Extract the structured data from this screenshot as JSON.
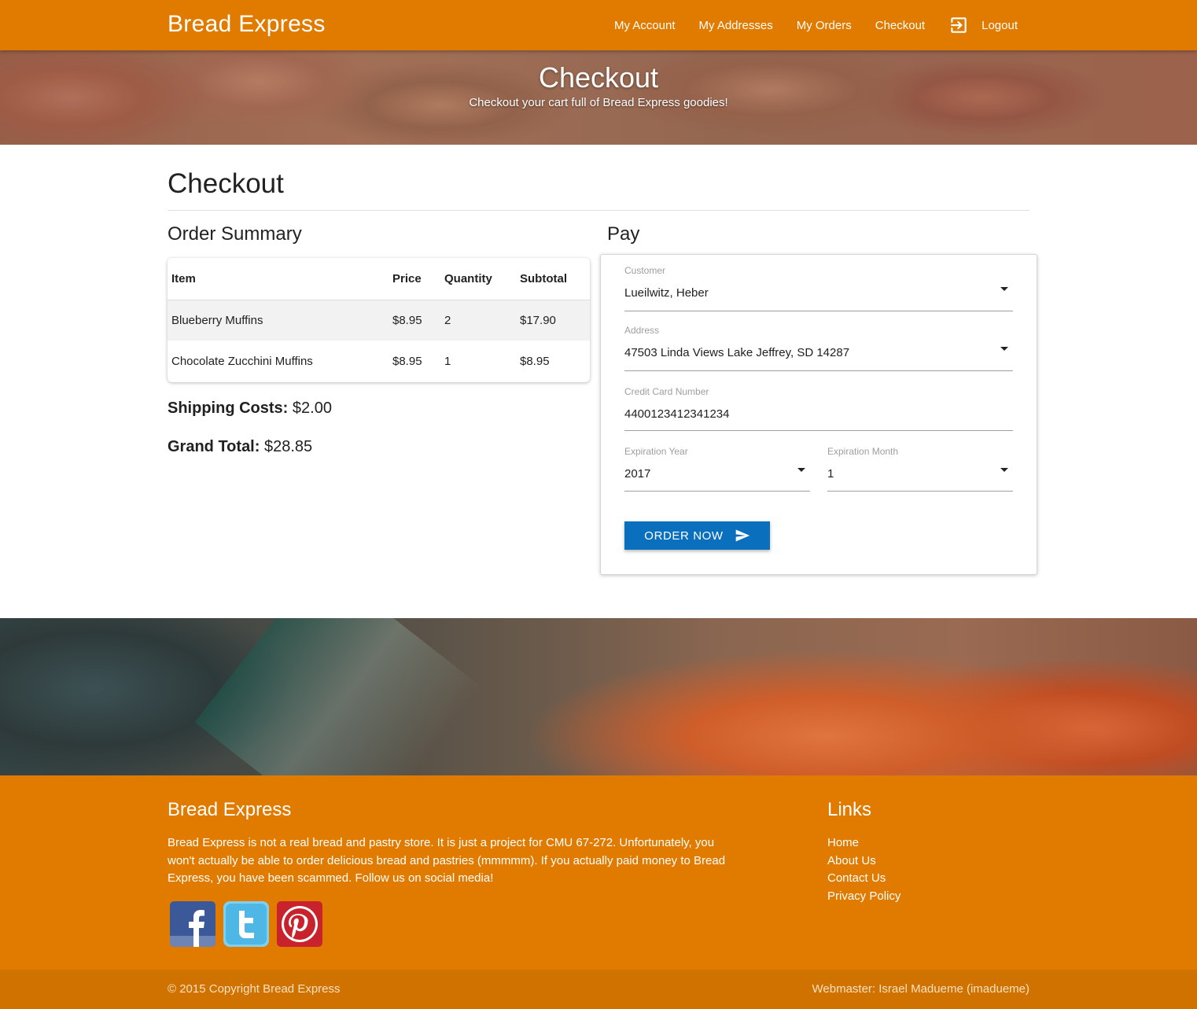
{
  "nav": {
    "brand": "Bread Express",
    "links": [
      "My Account",
      "My Addresses",
      "My Orders",
      "Checkout",
      "Logout"
    ],
    "logout_icon": "logout-icon"
  },
  "hero": {
    "title": "Checkout",
    "subtitle": "Checkout your cart full of Bread Express goodies!"
  },
  "main": {
    "title": "Checkout",
    "order_summary": {
      "heading": "Order Summary",
      "columns": [
        "Item",
        "Price",
        "Quantity",
        "Subtotal"
      ],
      "rows": [
        {
          "item": "Blueberry Muffins",
          "price": "$8.95",
          "quantity": "2",
          "subtotal": "$17.90"
        },
        {
          "item": "Chocolate Zucchini Muffins",
          "price": "$8.95",
          "quantity": "1",
          "subtotal": "$8.95"
        }
      ],
      "shipping_label": "Shipping Costs:",
      "shipping_value": "$2.00",
      "grand_total_label": "Grand Total:",
      "grand_total_value": "$28.85"
    },
    "pay": {
      "heading": "Pay",
      "customer": {
        "label": "Customer",
        "value": "Lueilwitz, Heber"
      },
      "address": {
        "label": "Address",
        "value": "47503 Linda Views Lake Jeffrey, SD 14287"
      },
      "credit_card": {
        "label": "Credit Card Number",
        "value": "4400123412341234"
      },
      "exp_year": {
        "label": "Expiration Year",
        "value": "2017"
      },
      "exp_month": {
        "label": "Expiration Month",
        "value": "1"
      },
      "button": "ORDER NOW",
      "button_icon": "send-icon",
      "button_color": "#0a6fbd"
    }
  },
  "footer": {
    "brand": "Bread Express",
    "text": "Bread Express is not a real bread and pastry store. It is just a project for CMU 67-272. Unfortunately, you won't actually be able to order delicious bread and pastries (mmmmm). If you actually paid money to Bread Express, you have been scammed. Follow us on social media!",
    "links_heading": "Links",
    "links": [
      "Home",
      "About Us",
      "Contact Us",
      "Privacy Policy"
    ],
    "social": [
      "facebook-icon",
      "twitter-icon",
      "pinterest-icon"
    ],
    "copyright": "© 2015 Copyright Bread Express",
    "webmaster": "Webmaster: Israel Madueme (imadueme)"
  },
  "colors": {
    "brand_orange": "#e07b00",
    "footer_bottom": "#cf7200",
    "button_blue": "#0a6fbd"
  }
}
